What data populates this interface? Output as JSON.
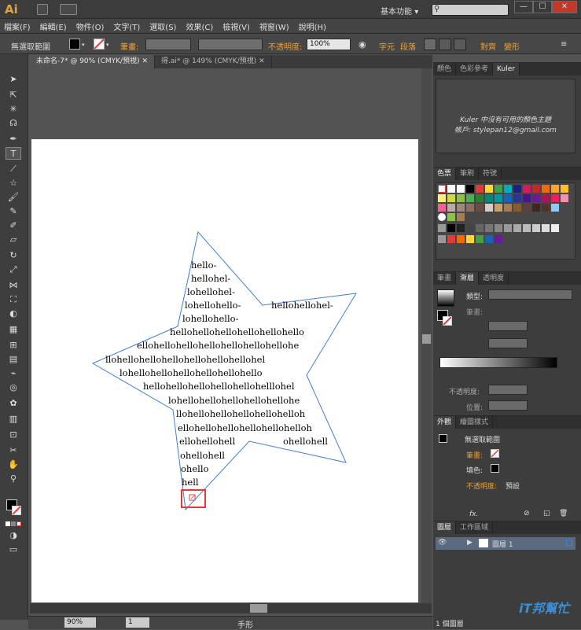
{
  "app": {
    "logo": "Ai",
    "workspace": "基本功能",
    "workspace_arrow": "▾"
  },
  "window_controls": {
    "minimize": "—",
    "maximize": "☐",
    "close": "✕"
  },
  "menu": [
    "檔案(F)",
    "編輯(E)",
    "物件(O)",
    "文字(T)",
    "選取(S)",
    "效果(C)",
    "檢視(V)",
    "視窗(W)",
    "說明(H)"
  ],
  "control_bar": {
    "selection_label": "無選取範圍",
    "stroke_label": "筆畫:",
    "opacity_label": "不透明度:",
    "opacity_value": "100%",
    "char_label": "字元",
    "para_label": "段落",
    "align_label": "對齊",
    "transform_label": "變形"
  },
  "doc_tabs": [
    {
      "label": "未命名-7* @ 90% (CMYK/預視)",
      "close": "✕"
    },
    {
      "label": "得.ai* @ 149% (CMYK/預視)",
      "close": "✕"
    }
  ],
  "tools": [
    "selection-tool",
    "direct-selection-tool",
    "magic-wand-tool",
    "lasso-tool",
    "pen-tool",
    "type-tool",
    "line-tool",
    "shape-tool",
    "paintbrush-tool",
    "pencil-tool",
    "blob-brush-tool",
    "eraser-tool",
    "rotate-tool",
    "scale-tool",
    "width-tool",
    "free-transform-tool",
    "shape-builder-tool",
    "perspective-grid-tool",
    "mesh-tool",
    "gradient-tool",
    "eyedropper-tool",
    "blend-tool",
    "symbol-sprayer-tool",
    "column-graph-tool",
    "artboard-tool",
    "slice-tool",
    "hand-tool",
    "zoom-tool"
  ],
  "canvas_text": [
    "hello-",
    "hellohel-",
    "lohellohel-",
    "lohellohello-",
    "lohellohello-",
    "hellohellohellohellohellohello",
    "ellohellohellohellohellohellohellohe",
    "llohellohellohellohellohellohellohel",
    "lohellohellohellohellohellohello",
    "hellohellohellohellohellohelllohel",
    "lohellohellohellohellohellohe",
    "llohellohellohellohellohelloh",
    "ellohellohellohellohellohelloh",
    "ellohellohell",
    "ohellohell",
    "ohello",
    "hell"
  ],
  "canvas_text_right": [
    "hellohellohel-",
    "ohellohell"
  ],
  "status": {
    "zoom": "90%",
    "page": "1",
    "tool_name": "手形"
  },
  "kuler_panel": {
    "tabs": [
      "顏色",
      "色彩參考",
      "Kuler"
    ],
    "message_line1": "Kuler 中沒有可用的顏色主題",
    "message_line2": "帳戶: stylepan12@gmail.com"
  },
  "swatch_panel": {
    "tabs": [
      "色票",
      "筆刷",
      "符號"
    ]
  },
  "gradient_panel": {
    "tabs": [
      "筆畫",
      "漸層",
      "透明度"
    ],
    "type_label": "類型:",
    "stroke_label": "筆畫:",
    "opacity_label": "不透明度:",
    "position_label": "位置:"
  },
  "appearance_panel": {
    "tabs": [
      "外觀",
      "繪圖樣式"
    ],
    "title": "無選取範圍",
    "stroke_label": "筆畫:",
    "fill_label": "填色:",
    "opacity_label": "不透明度:",
    "opacity_value": "預設",
    "fx_label": "fx."
  },
  "layers_panel": {
    "tabs": [
      "圖層",
      "工作區域"
    ],
    "layer_name": "圖層 1",
    "footer": "1 個圖層"
  },
  "watermark": "iT邦幫忙",
  "colors": {
    "accent_orange": "#f0a030",
    "selection_red": "#e53935",
    "path_blue": "#3d7ed9"
  }
}
